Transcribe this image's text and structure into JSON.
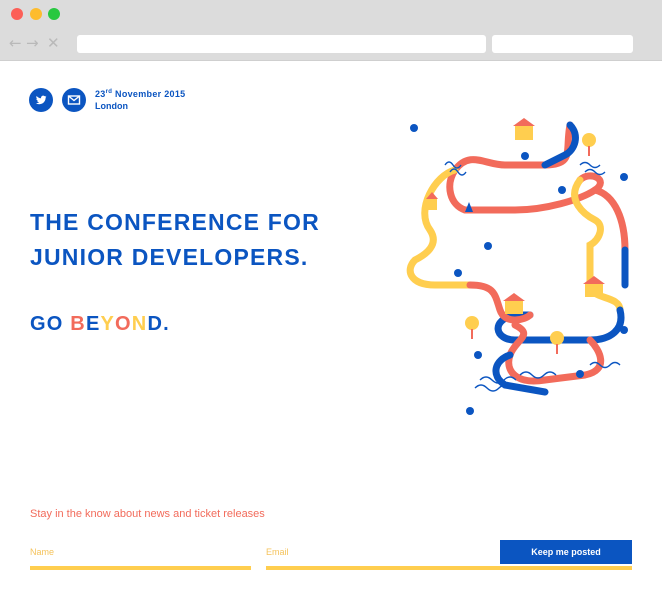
{
  "browser": {
    "nav_back": "←",
    "nav_forward": "→",
    "nav_close": "✕"
  },
  "event": {
    "date_day": "23",
    "date_suffix": "rd",
    "date_rest": " November 2015",
    "city": "London"
  },
  "hero": {
    "headline_line1": "THE CONFERENCE FOR",
    "headline_line2": "JUNIOR  DEVELOPERS.",
    "tagline_prefix": "GO ",
    "tagline_letters": [
      "B",
      "E",
      "Y",
      "O",
      "N",
      "D"
    ],
    "tagline_suffix": "."
  },
  "newsletter": {
    "prompt": "Stay in the know about news and ticket releases",
    "name_placeholder": "Name",
    "email_placeholder": "Email",
    "submit_label": "Keep me posted"
  },
  "colors": {
    "brand_blue": "#0b55c1",
    "accent_coral": "#f26b5b",
    "accent_yellow": "#ffce4f"
  },
  "icons": [
    "twitter-icon",
    "mail-icon"
  ]
}
